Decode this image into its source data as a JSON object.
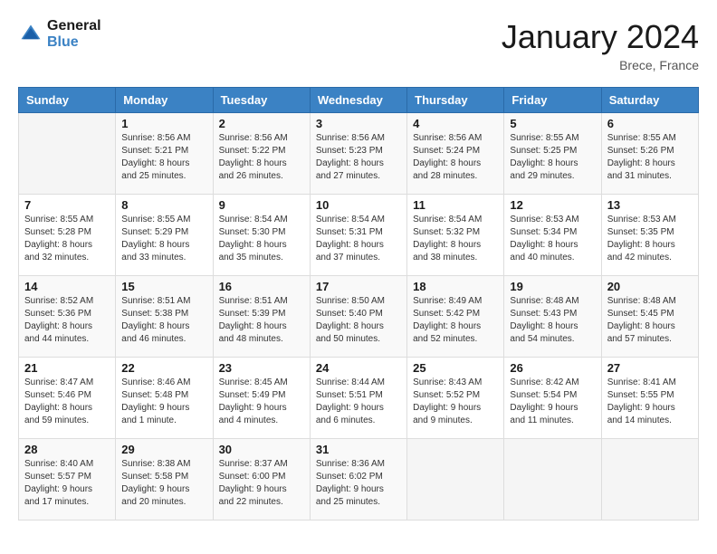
{
  "logo": {
    "line1": "General",
    "line2": "Blue"
  },
  "title": "January 2024",
  "location": "Brece, France",
  "weekdays": [
    "Sunday",
    "Monday",
    "Tuesday",
    "Wednesday",
    "Thursday",
    "Friday",
    "Saturday"
  ],
  "weeks": [
    [
      {
        "day": "",
        "sunrise": "",
        "sunset": "",
        "daylight": ""
      },
      {
        "day": "1",
        "sunrise": "Sunrise: 8:56 AM",
        "sunset": "Sunset: 5:21 PM",
        "daylight": "Daylight: 8 hours and 25 minutes."
      },
      {
        "day": "2",
        "sunrise": "Sunrise: 8:56 AM",
        "sunset": "Sunset: 5:22 PM",
        "daylight": "Daylight: 8 hours and 26 minutes."
      },
      {
        "day": "3",
        "sunrise": "Sunrise: 8:56 AM",
        "sunset": "Sunset: 5:23 PM",
        "daylight": "Daylight: 8 hours and 27 minutes."
      },
      {
        "day": "4",
        "sunrise": "Sunrise: 8:56 AM",
        "sunset": "Sunset: 5:24 PM",
        "daylight": "Daylight: 8 hours and 28 minutes."
      },
      {
        "day": "5",
        "sunrise": "Sunrise: 8:55 AM",
        "sunset": "Sunset: 5:25 PM",
        "daylight": "Daylight: 8 hours and 29 minutes."
      },
      {
        "day": "6",
        "sunrise": "Sunrise: 8:55 AM",
        "sunset": "Sunset: 5:26 PM",
        "daylight": "Daylight: 8 hours and 31 minutes."
      }
    ],
    [
      {
        "day": "7",
        "sunrise": "Sunrise: 8:55 AM",
        "sunset": "Sunset: 5:28 PM",
        "daylight": "Daylight: 8 hours and 32 minutes."
      },
      {
        "day": "8",
        "sunrise": "Sunrise: 8:55 AM",
        "sunset": "Sunset: 5:29 PM",
        "daylight": "Daylight: 8 hours and 33 minutes."
      },
      {
        "day": "9",
        "sunrise": "Sunrise: 8:54 AM",
        "sunset": "Sunset: 5:30 PM",
        "daylight": "Daylight: 8 hours and 35 minutes."
      },
      {
        "day": "10",
        "sunrise": "Sunrise: 8:54 AM",
        "sunset": "Sunset: 5:31 PM",
        "daylight": "Daylight: 8 hours and 37 minutes."
      },
      {
        "day": "11",
        "sunrise": "Sunrise: 8:54 AM",
        "sunset": "Sunset: 5:32 PM",
        "daylight": "Daylight: 8 hours and 38 minutes."
      },
      {
        "day": "12",
        "sunrise": "Sunrise: 8:53 AM",
        "sunset": "Sunset: 5:34 PM",
        "daylight": "Daylight: 8 hours and 40 minutes."
      },
      {
        "day": "13",
        "sunrise": "Sunrise: 8:53 AM",
        "sunset": "Sunset: 5:35 PM",
        "daylight": "Daylight: 8 hours and 42 minutes."
      }
    ],
    [
      {
        "day": "14",
        "sunrise": "Sunrise: 8:52 AM",
        "sunset": "Sunset: 5:36 PM",
        "daylight": "Daylight: 8 hours and 44 minutes."
      },
      {
        "day": "15",
        "sunrise": "Sunrise: 8:51 AM",
        "sunset": "Sunset: 5:38 PM",
        "daylight": "Daylight: 8 hours and 46 minutes."
      },
      {
        "day": "16",
        "sunrise": "Sunrise: 8:51 AM",
        "sunset": "Sunset: 5:39 PM",
        "daylight": "Daylight: 8 hours and 48 minutes."
      },
      {
        "day": "17",
        "sunrise": "Sunrise: 8:50 AM",
        "sunset": "Sunset: 5:40 PM",
        "daylight": "Daylight: 8 hours and 50 minutes."
      },
      {
        "day": "18",
        "sunrise": "Sunrise: 8:49 AM",
        "sunset": "Sunset: 5:42 PM",
        "daylight": "Daylight: 8 hours and 52 minutes."
      },
      {
        "day": "19",
        "sunrise": "Sunrise: 8:48 AM",
        "sunset": "Sunset: 5:43 PM",
        "daylight": "Daylight: 8 hours and 54 minutes."
      },
      {
        "day": "20",
        "sunrise": "Sunrise: 8:48 AM",
        "sunset": "Sunset: 5:45 PM",
        "daylight": "Daylight: 8 hours and 57 minutes."
      }
    ],
    [
      {
        "day": "21",
        "sunrise": "Sunrise: 8:47 AM",
        "sunset": "Sunset: 5:46 PM",
        "daylight": "Daylight: 8 hours and 59 minutes."
      },
      {
        "day": "22",
        "sunrise": "Sunrise: 8:46 AM",
        "sunset": "Sunset: 5:48 PM",
        "daylight": "Daylight: 9 hours and 1 minute."
      },
      {
        "day": "23",
        "sunrise": "Sunrise: 8:45 AM",
        "sunset": "Sunset: 5:49 PM",
        "daylight": "Daylight: 9 hours and 4 minutes."
      },
      {
        "day": "24",
        "sunrise": "Sunrise: 8:44 AM",
        "sunset": "Sunset: 5:51 PM",
        "daylight": "Daylight: 9 hours and 6 minutes."
      },
      {
        "day": "25",
        "sunrise": "Sunrise: 8:43 AM",
        "sunset": "Sunset: 5:52 PM",
        "daylight": "Daylight: 9 hours and 9 minutes."
      },
      {
        "day": "26",
        "sunrise": "Sunrise: 8:42 AM",
        "sunset": "Sunset: 5:54 PM",
        "daylight": "Daylight: 9 hours and 11 minutes."
      },
      {
        "day": "27",
        "sunrise": "Sunrise: 8:41 AM",
        "sunset": "Sunset: 5:55 PM",
        "daylight": "Daylight: 9 hours and 14 minutes."
      }
    ],
    [
      {
        "day": "28",
        "sunrise": "Sunrise: 8:40 AM",
        "sunset": "Sunset: 5:57 PM",
        "daylight": "Daylight: 9 hours and 17 minutes."
      },
      {
        "day": "29",
        "sunrise": "Sunrise: 8:38 AM",
        "sunset": "Sunset: 5:58 PM",
        "daylight": "Daylight: 9 hours and 20 minutes."
      },
      {
        "day": "30",
        "sunrise": "Sunrise: 8:37 AM",
        "sunset": "Sunset: 6:00 PM",
        "daylight": "Daylight: 9 hours and 22 minutes."
      },
      {
        "day": "31",
        "sunrise": "Sunrise: 8:36 AM",
        "sunset": "Sunset: 6:02 PM",
        "daylight": "Daylight: 9 hours and 25 minutes."
      },
      {
        "day": "",
        "sunrise": "",
        "sunset": "",
        "daylight": ""
      },
      {
        "day": "",
        "sunrise": "",
        "sunset": "",
        "daylight": ""
      },
      {
        "day": "",
        "sunrise": "",
        "sunset": "",
        "daylight": ""
      }
    ]
  ]
}
